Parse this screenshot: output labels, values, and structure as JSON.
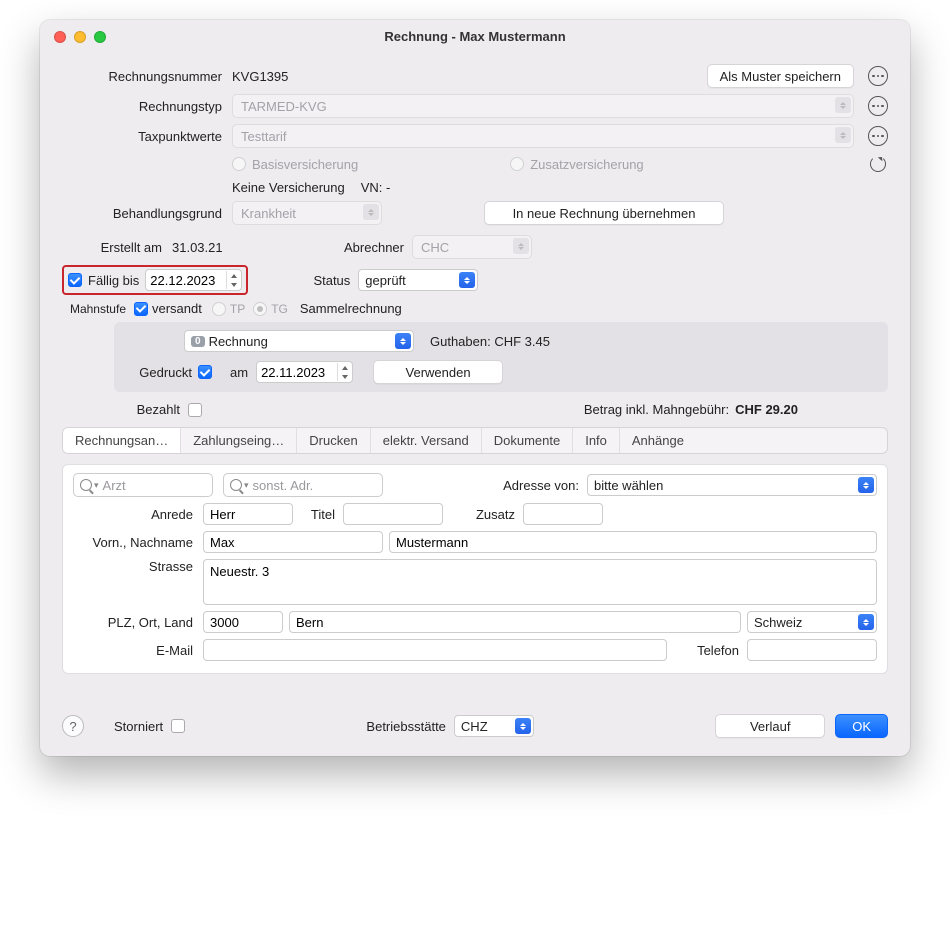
{
  "window": {
    "title": "Rechnung - Max Mustermann"
  },
  "labels": {
    "invoice_no": "Rechnungsnummer",
    "invoice_type": "Rechnungstyp",
    "taxpoints": "Taxpunktwerte",
    "treatment_reason": "Behandlungsgrund",
    "created": "Erstellt am",
    "due": "Fällig bis",
    "biller": "Abrechner",
    "status": "Status",
    "dunlevel": "Mahnstufe",
    "sent": "versandt",
    "tp": "TP",
    "tg": "TG",
    "group_invoice": "Sammelrechnung",
    "printed": "Gedruckt",
    "on": "am",
    "paid": "Bezahlt",
    "amount_label": "Betrag inkl. Mahngebühr:",
    "addr_from": "Adresse von:",
    "salutation": "Anrede",
    "title": "Titel",
    "suffix": "Zusatz",
    "firstname_lastname": "Vorn., Nachname",
    "street": "Strasse",
    "zip_city_country": "PLZ, Ort, Land",
    "email": "E-Mail",
    "phone": "Telefon",
    "cancelled": "Storniert",
    "site": "Betriebsstätte"
  },
  "values": {
    "invoice_no": "KVG1395",
    "invoice_type": "TARMED-KVG",
    "taxpoints": "Testtarif",
    "basic_ins": "Basisversicherung",
    "add_ins": "Zusatzversicherung",
    "no_insurance": "Keine Versicherung",
    "vn": "VN: -",
    "treatment_reason": "Krankheit",
    "created": "31.03.21",
    "due_date": "22.12.2023",
    "biller": "CHC",
    "status": "geprüft",
    "dun_select": "Rechnung",
    "credit": "Guthaben: CHF 3.45",
    "printed_date": "22.11.2023",
    "amount": "CHF 29.20",
    "addr_select": "bitte wählen",
    "salutation": "Herr",
    "title_val": "",
    "suffix_val": "",
    "firstname": "Max",
    "lastname": "Mustermann",
    "street": "Neuestr. 3",
    "zip": "3000",
    "city": "Bern",
    "country": "Schweiz",
    "email": "",
    "phone": "",
    "site": "CHZ"
  },
  "placeholders": {
    "search_doctor": "Arzt",
    "search_other": "sonst. Adr."
  },
  "buttons": {
    "save_template": "Als Muster speichern",
    "take_to_new": "In neue Rechnung übernehmen",
    "use": "Verwenden",
    "history": "Verlauf",
    "ok": "OK"
  },
  "tabs": [
    "Rechnungsan…",
    "Zahlungseing…",
    "Drucken",
    "elektr. Versand",
    "Dokumente",
    "Info",
    "Anhänge"
  ]
}
